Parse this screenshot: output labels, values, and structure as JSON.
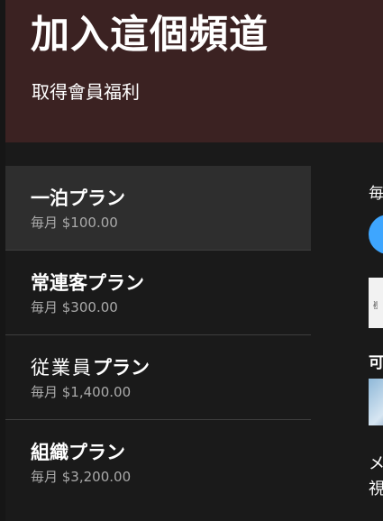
{
  "header": {
    "title": "加入這個頻道",
    "subtitle": "取得會員福利"
  },
  "plans": [
    {
      "name": "一泊プラン",
      "price": "毎月 $100.00",
      "selected": true
    },
    {
      "name": "常連客プラン",
      "price": "毎月 $300.00",
      "selected": false
    },
    {
      "name_part1": "従業員",
      "name_part2": "プラン",
      "price": "毎月 $1,400.00",
      "selected": false
    },
    {
      "name": "組織プラン",
      "price": "毎月 $3,200.00",
      "selected": false
    }
  ],
  "detail": {
    "monthly_fragment": "毎",
    "available_fragment": "可",
    "message_fragment_1": "メ",
    "message_fragment_2": "視"
  },
  "colors": {
    "header_bg": "#3b2222",
    "panel_bg": "#1a1a1a",
    "selected_bg": "#2e2e2e",
    "accent": "#3ea6ff"
  }
}
